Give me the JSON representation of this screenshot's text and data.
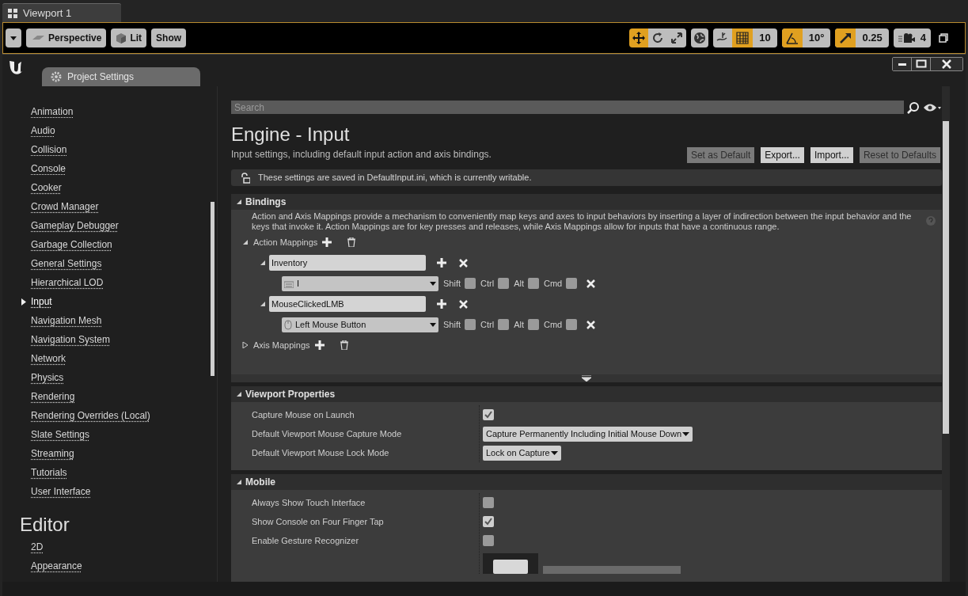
{
  "viewport_tab": {
    "title": "Viewport 1"
  },
  "viewport_toolbar": {
    "left_buttons": [
      {
        "kind": "perspective",
        "label": "Perspective"
      },
      {
        "kind": "lit",
        "label": "Lit"
      },
      {
        "kind": "plain",
        "label": "Show"
      }
    ],
    "transform_modes": [
      {
        "selected": true
      },
      {
        "selected": false
      },
      {
        "selected": false
      }
    ],
    "snaps": [
      {
        "kind": "grid",
        "on": true,
        "value": "10"
      },
      {
        "kind": "rotation",
        "on": true,
        "value": "10°"
      },
      {
        "kind": "scale",
        "on": true,
        "value": "0.25"
      }
    ],
    "camera_speed": "4"
  },
  "settings_window": {
    "tab_title": "Project Settings"
  },
  "sidebar": {
    "groups": [
      {
        "items": [
          {
            "label": "Animation",
            "selected": false
          },
          {
            "label": "Audio",
            "selected": false
          },
          {
            "label": "Collision",
            "selected": false
          },
          {
            "label": "Console",
            "selected": false
          },
          {
            "label": "Cooker",
            "selected": false
          },
          {
            "label": "Crowd Manager",
            "selected": false
          },
          {
            "label": "Gameplay Debugger",
            "selected": false
          },
          {
            "label": "Garbage Collection",
            "selected": false
          },
          {
            "label": "General Settings",
            "selected": false
          },
          {
            "label": "Hierarchical LOD",
            "selected": false
          },
          {
            "label": "Input",
            "selected": true
          },
          {
            "label": "Navigation Mesh",
            "selected": false
          },
          {
            "label": "Navigation System",
            "selected": false
          },
          {
            "label": "Network",
            "selected": false
          },
          {
            "label": "Physics",
            "selected": false
          },
          {
            "label": "Rendering",
            "selected": false
          },
          {
            "label": "Rendering Overrides (Local)",
            "selected": false
          },
          {
            "label": "Slate Settings",
            "selected": false
          },
          {
            "label": "Streaming",
            "selected": false
          },
          {
            "label": "Tutorials",
            "selected": false
          },
          {
            "label": "User Interface",
            "selected": false
          }
        ]
      },
      {
        "heading": "Editor",
        "items": [
          {
            "label": "2D",
            "selected": false
          },
          {
            "label": "Appearance",
            "selected": false
          }
        ]
      }
    ]
  },
  "search": {
    "placeholder": "Search"
  },
  "page": {
    "title": "Engine - Input",
    "description": "Input settings, including default input action and axis bindings.",
    "buttons": [
      {
        "label": "Set as Default",
        "disabled": true
      },
      {
        "label": "Export...",
        "disabled": false
      },
      {
        "label": "Import...",
        "disabled": false
      },
      {
        "label": "Reset to Defaults",
        "disabled": true
      }
    ],
    "notice": "These settings are saved in DefaultInput.ini, which is currently writable."
  },
  "bindings": {
    "title": "Bindings",
    "expanded": true,
    "description": "Action and Axis Mappings provide a mechanism to conveniently map keys and axes to input behaviors by inserting a layer of indirection between the input behavior and the keys that invoke it. Action Mappings are for key presses and releases, while Axis Mappings allow for inputs that have a continuous range.",
    "groups": [
      {
        "label": "Action Mappings",
        "expanded": true,
        "mappings": [
          {
            "name": "Inventory",
            "expanded": true,
            "keys": [
              {
                "kind": "keyboard",
                "key": "I",
                "modifiers": [
                  {
                    "label": "Shift",
                    "checked": false
                  },
                  {
                    "label": "Ctrl",
                    "checked": false
                  },
                  {
                    "label": "Alt",
                    "checked": false
                  },
                  {
                    "label": "Cmd",
                    "checked": false
                  }
                ]
              }
            ]
          },
          {
            "name": "MouseClickedLMB",
            "expanded": true,
            "keys": [
              {
                "kind": "mouse",
                "key": "Left Mouse Button",
                "modifiers": [
                  {
                    "label": "Shift",
                    "checked": false
                  },
                  {
                    "label": "Ctrl",
                    "checked": false
                  },
                  {
                    "label": "Alt",
                    "checked": false
                  },
                  {
                    "label": "Cmd",
                    "checked": false
                  }
                ]
              }
            ]
          }
        ]
      },
      {
        "label": "Axis Mappings",
        "expanded": false
      }
    ]
  },
  "sections": [
    {
      "title": "Viewport Properties",
      "expanded": true,
      "rows": [
        {
          "kind": "checkbox",
          "label": "Capture Mouse on Launch",
          "checked": true
        },
        {
          "kind": "dropdown",
          "label": "Default Viewport Mouse Capture Mode",
          "value": "Capture Permanently Including Initial Mouse Down"
        },
        {
          "kind": "dropdown",
          "label": "Default Viewport Mouse Lock Mode",
          "value": "Lock on Capture"
        }
      ]
    },
    {
      "title": "Mobile",
      "expanded": true,
      "rows": [
        {
          "kind": "checkbox",
          "label": "Always Show Touch Interface",
          "checked": false
        },
        {
          "kind": "checkbox",
          "label": "Show Console on Four Finger Tap",
          "checked": true
        },
        {
          "kind": "checkbox",
          "label": "Enable Gesture Recognizer",
          "checked": false
        },
        {
          "kind": "thumbnail"
        }
      ]
    }
  ]
}
